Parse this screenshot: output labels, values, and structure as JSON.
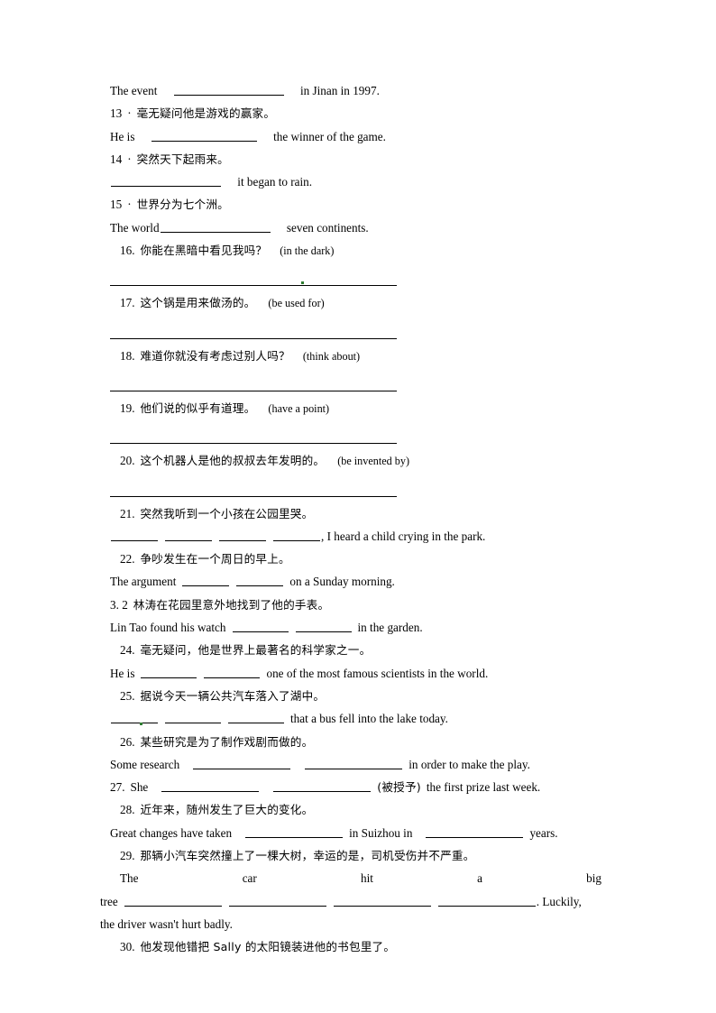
{
  "document": {
    "type": "chinese-english-translation-worksheet",
    "language_mix": "zh-CN + en"
  },
  "lines": {
    "l0_en": "The event",
    "l0_en_tail": "in Jinan in 1997.",
    "q13_num": "13",
    "q13_sep": "·",
    "q13_zh": "毫无疑问他是游戏的赢家。",
    "q13_en_head": "He is",
    "q13_en_tail": "the winner of the game.",
    "q14_num": "14",
    "q14_sep": "·",
    "q14_zh": "突然天下起雨来。",
    "q14_en_tail": "it began to rain.",
    "q15_num": "15",
    "q15_sep": "·",
    "q15_zh": "世界分为七个洲。",
    "q15_en_head": "The world",
    "q15_en_tail": "seven continents.",
    "q16_num": "16.",
    "q16_zh": "你能在黑暗中看见我吗？",
    "q16_hint": "(in the dark)",
    "q17_num": "17.",
    "q17_zh": "这个锅是用来做汤的。",
    "q17_hint": "(be used for)",
    "q18_num": "18.",
    "q18_zh": "难道你就没有考虑过别人吗？",
    "q18_hint": "(think about)",
    "q19_num": "19.",
    "q19_zh": "他们说的似乎有道理。",
    "q19_hint": "(have a point)",
    "q20_num": "20.",
    "q20_zh": "这个机器人是他的叔叔去年发明的。",
    "q20_hint": "(be invented by)",
    "q21_num": "21.",
    "q21_zh": "突然我听到一个小孩在公园里哭。",
    "q21_en_tail": ", I heard a child crying in the park.",
    "q22_num": "22.",
    "q22_zh": "争吵发生在一个周日的早上。",
    "q22_en_head": "The argument",
    "q22_en_tail": "on a Sunday morning.",
    "q23_num": "3. 2",
    "q23_zh": "林涛在花园里意外地找到了他的手表。",
    "q23_en_head": "Lin Tao found his watch",
    "q23_en_tail": "in the garden.",
    "q24_num": "24.",
    "q24_zh": "毫无疑问，他是世界上最著名的科学家之一。",
    "q24_en_head": "He is",
    "q24_en_tail": "one of the most famous scientists in the world.",
    "q25_num": "25.",
    "q25_zh": "据说今天一辆公共汽车落入了湖中。",
    "q25_en_tail": "that a bus fell into the lake today.",
    "q26_num": "26.",
    "q26_zh": "某些研究是为了制作戏剧而做的。",
    "q26_en_head": "Some research",
    "q26_en_tail": "in order to make the play.",
    "q27_num": "27.",
    "q27_en_head": "She",
    "q27_zh_hint": "(被授予)",
    "q27_en_tail": "the first prize last week.",
    "q28_num": "28.",
    "q28_zh": "近年来，随州发生了巨大的变化。",
    "q28_en_head": "Great changes have taken",
    "q28_en_mid": "in Suizhou in",
    "q28_en_tail": "years.",
    "q29_num": "29.",
    "q29_zh": "那辆小汽车突然撞上了一棵大树，幸运的是，司机受伤并不严重。",
    "q29_w1": "The",
    "q29_w2": "car",
    "q29_w3": "hit",
    "q29_w4": "a",
    "q29_w5": "big",
    "q29_w6": "tree",
    "q29_en_tail": ". Luckily,",
    "q29_en_last": "the driver wasn't hurt badly.",
    "q30_num": "30.",
    "q30_zh": "他发现他错把 Sally 的太阳镜装进他的书包里了。"
  }
}
